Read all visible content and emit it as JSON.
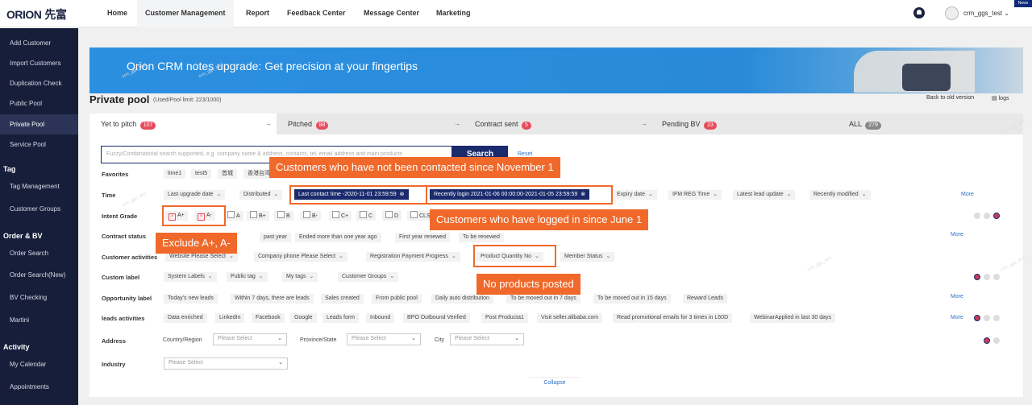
{
  "header": {
    "logo": "ORION",
    "logo_cn": "先富",
    "nav": [
      "Home",
      "Customer Management",
      "Report",
      "Feedback Center",
      "Message Center",
      "Marketing"
    ],
    "active_nav": "Customer Management",
    "username": "crm_ggs_test",
    "news": "News"
  },
  "sidebar": {
    "items": [
      "Add Customer",
      "Import Customers",
      "Duplication Check",
      "Public Pool",
      "Private Pool",
      "Service Pool"
    ],
    "tag_group": "Tag",
    "tag_items": [
      "Tag Management",
      "Customer Groups"
    ],
    "order_group": "Order & BV",
    "order_items": [
      "Order Search",
      "Order Search(New)",
      "BV Checking",
      "Martini"
    ],
    "activity_group": "Activity",
    "activity_items": [
      "My Calendar",
      "Appointments"
    ]
  },
  "banner": {
    "text": "Orion CRM notes upgrade: Get precision at your fingertips"
  },
  "page": {
    "title": "Private pool",
    "meta": "(Used/Pool limit:  223/1000)",
    "back_old": "Back to old version",
    "logs": "logs"
  },
  "tabs": [
    {
      "label": "Yet to pitch",
      "count": "107"
    },
    {
      "label": "Pitched",
      "count": "88"
    },
    {
      "label": "Contract sent",
      "count": "5"
    },
    {
      "label": "Pending BV",
      "count": "23"
    },
    {
      "label": "ALL",
      "count": "279"
    }
  ],
  "search": {
    "placeholder": "Fuzzy/Combinatorial search supported, e.g. company name & address, contacts, tel, email address and main products",
    "button": "Search",
    "reset": "Reset"
  },
  "rows": {
    "favorites": {
      "label": "Favorites",
      "chips": [
        "time1",
        "test5",
        "首城",
        "香港台湾"
      ]
    },
    "time": {
      "label": "Time",
      "chips": [
        "Last upgrade date",
        "Distributed",
        "Expiry date",
        "IFM REG Time",
        "Latest lead update",
        "Recently modified"
      ],
      "active1": "Last contact time  -2020-11-01 23:59:59",
      "active2": "Recently login  2021-01-06 00:00:00-2021-01-05 23:59:59",
      "more": "More"
    },
    "intent": {
      "label": "Intent Grade",
      "options": [
        "A+",
        "A-",
        "A",
        "B+",
        "B",
        "B-",
        "C+",
        "C",
        "D",
        "CLS"
      ]
    },
    "contract": {
      "label": "Contract status",
      "chips": [
        "past year",
        "Ended more than one year ago",
        "First year renewed",
        "To be renewed"
      ],
      "more": "More"
    },
    "activities": {
      "label": "Customer activities",
      "website": "Website",
      "website_v": "Please Select",
      "phone": "Company phone",
      "phone_v": "Please Select",
      "reg": "Registration Payment Progress",
      "pq": "Product Quantity",
      "pq_v": "No",
      "member": "Member Status"
    },
    "custom": {
      "label": "Custom label",
      "chips": [
        "System Labels",
        "Public tag",
        "My tags",
        "Customer Groups"
      ]
    },
    "opportunity": {
      "label": "Opportunity label",
      "chips": [
        "Today's new leads",
        "Within 7 days, there are leads",
        "Sales created",
        "From public pool",
        "Daily auto distribution",
        "To be moved out in 7 days",
        "To be moved out in 15 days",
        "Reward Leads"
      ],
      "more": "More"
    },
    "leads": {
      "label": "leads activities",
      "chips": [
        "Data enriched",
        "LinkedIn",
        "Facebook",
        "Google",
        "Leads form",
        "Inbound",
        "BPO Outbound Verified",
        "Post Producta1",
        "Visit seller.alibaba.com",
        "Read promotional emails for 3 times in L60D",
        "WebinarApplied in last 30 days"
      ],
      "more": "More"
    },
    "address": {
      "label": "Address",
      "country": "Country/Region",
      "province": "Province/State",
      "city": "City",
      "placeholder": "Please Select"
    },
    "industry": {
      "label": "Industry",
      "placeholder": "Please Select"
    }
  },
  "collapse": "Collapse",
  "watermark": "crm_ggs_test",
  "callouts": {
    "c1": "Customers who have not been contacted since November 1",
    "c2": "Customers who have logged in since June 1",
    "c3": "Exclude A+, A-",
    "c4": "No products posted"
  }
}
